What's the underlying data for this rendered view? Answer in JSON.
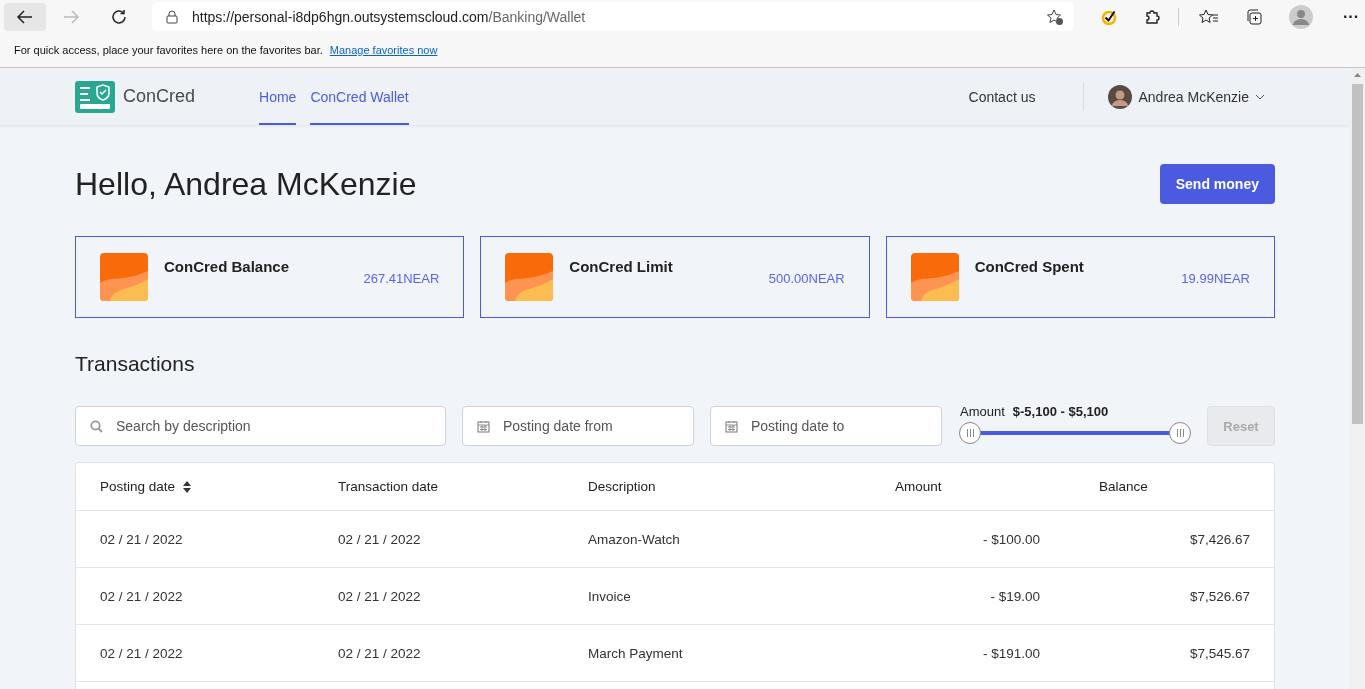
{
  "browser": {
    "url_host": "https://personal-i8dp6hgn.outsystemscloud.com",
    "url_path": "/Banking/Wallet",
    "favorites_prompt": "For quick access, place your favorites here on the favorites bar.",
    "favorites_link": "Manage favorites now",
    "more": "···"
  },
  "header": {
    "brand": "ConCred",
    "nav": [
      {
        "label": "Home",
        "selected": true
      },
      {
        "label": "ConCred Wallet",
        "selected": true
      }
    ],
    "contact": "Contact us",
    "user": "Andrea McKenzie"
  },
  "greeting": "Hello, Andrea McKenzie",
  "send_button": "Send money",
  "cards": [
    {
      "title": "ConCred Balance",
      "value": "267.41NEAR"
    },
    {
      "title": "ConCred Limit",
      "value": "500.00NEAR"
    },
    {
      "title": "ConCred Spent",
      "value": "19.99NEAR"
    }
  ],
  "transactions": {
    "title": "Transactions",
    "filters": {
      "search": {
        "placeholder": "Search by description"
      },
      "date_from": {
        "placeholder": "Posting date from"
      },
      "date_to": {
        "placeholder": "Posting date to"
      },
      "amount": {
        "label": "Amount",
        "range": "$-5,100 - $5,100"
      },
      "reset": {
        "label": "Reset",
        "disabled": true
      }
    },
    "columns": [
      "Posting date",
      "Transaction date",
      "Description",
      "Amount",
      "Balance"
    ],
    "rows": [
      [
        "02 / 21 / 2022",
        "02 / 21 / 2022",
        "Amazon-Watch",
        "- $100.00",
        "$7,426.67"
      ],
      [
        "02 / 21 / 2022",
        "02 / 21 / 2022",
        "Invoice",
        "- $19.00",
        "$7,526.67"
      ],
      [
        "02 / 21 / 2022",
        "02 / 21 / 2022",
        "March Payment",
        "- $191.00",
        "$7,545.67"
      ]
    ]
  }
}
